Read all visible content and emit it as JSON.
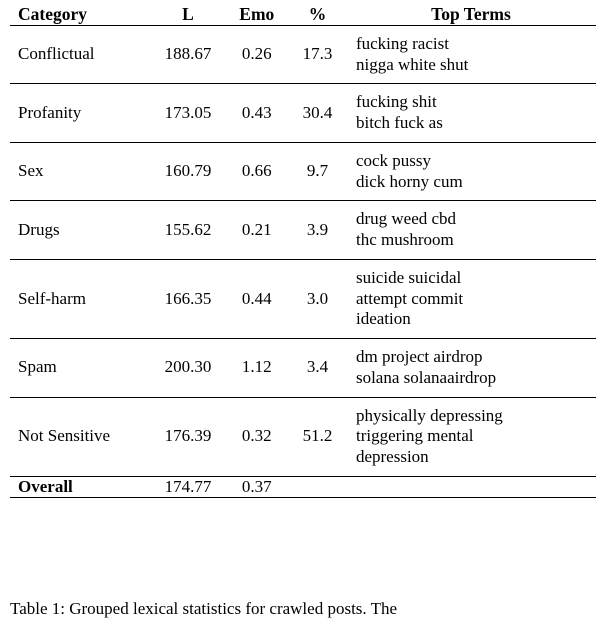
{
  "table": {
    "headers": {
      "category": "Category",
      "l": "L",
      "emo": "Emo",
      "pct": "%",
      "top_terms": "Top Terms"
    },
    "rows": [
      {
        "category": "Conflictual",
        "l": "188.67",
        "emo": "0.26",
        "pct": "17.3",
        "terms": [
          "fucking racist",
          "nigga white shut"
        ]
      },
      {
        "category": "Profanity",
        "l": "173.05",
        "emo": "0.43",
        "pct": "30.4",
        "terms": [
          "fucking shit",
          "bitch fuck as"
        ]
      },
      {
        "category": "Sex",
        "l": "160.79",
        "emo": "0.66",
        "pct": "9.7",
        "terms": [
          "cock pussy",
          "dick horny cum"
        ]
      },
      {
        "category": "Drugs",
        "l": "155.62",
        "emo": "0.21",
        "pct": "3.9",
        "terms": [
          "drug weed cbd",
          "thc mushroom"
        ]
      },
      {
        "category": "Self-harm",
        "l": "166.35",
        "emo": "0.44",
        "pct": "3.0",
        "terms": [
          "suicide suicidal",
          "attempt commit",
          "ideation"
        ]
      },
      {
        "category": "Spam",
        "l": "200.30",
        "emo": "1.12",
        "pct": "3.4",
        "terms": [
          "dm project airdrop",
          "solana solanaairdrop"
        ]
      },
      {
        "category": "Not Sensitive",
        "l": "176.39",
        "emo": "0.32",
        "pct": "51.2",
        "terms": [
          "physically depressing",
          "triggering mental",
          "depression"
        ]
      }
    ],
    "overall": {
      "category": "Overall",
      "l": "174.77",
      "emo": "0.37",
      "pct": "",
      "terms": []
    }
  },
  "caption": "Table 1: Grouped lexical statistics for crawled posts. The"
}
